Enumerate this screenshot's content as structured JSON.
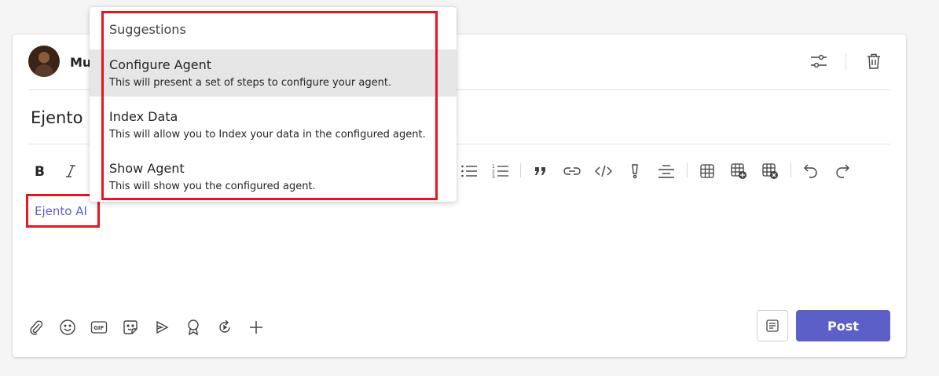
{
  "compose": {
    "user_name_partial": "Mu",
    "subject": "Ejento D",
    "mention": "Ejento AI",
    "post_label": "Post"
  },
  "header_icons": [
    "options-sliders-icon",
    "trash-icon"
  ],
  "format_toolbar": {
    "left": [
      "bold-icon",
      "italic-icon"
    ],
    "right": [
      "bulleted-list-icon",
      "numbered-list-icon",
      "quote-icon",
      "link-icon",
      "code-icon",
      "highlight-icon",
      "align-icon",
      "table-icon",
      "insert-table-icon",
      "delete-table-icon",
      "undo-icon",
      "redo-icon"
    ]
  },
  "bottom_toolbar": [
    "attach-icon",
    "emoji-icon",
    "gif-icon",
    "sticker-icon",
    "stream-icon",
    "praise-icon",
    "loop-icon",
    "add-icon"
  ],
  "suggestions": {
    "title": "Suggestions",
    "items": [
      {
        "title": "Configure Agent",
        "description": "This will present a set of steps to configure your agent."
      },
      {
        "title": "Index Data",
        "description": "This will allow you to Index your data in the configured agent."
      },
      {
        "title": "Show Agent",
        "description": "This will show you the configured agent."
      }
    ]
  },
  "colors": {
    "accent": "#5b5fc7",
    "highlight_box": "#e8141e",
    "active_row": "#e6e6e6"
  }
}
